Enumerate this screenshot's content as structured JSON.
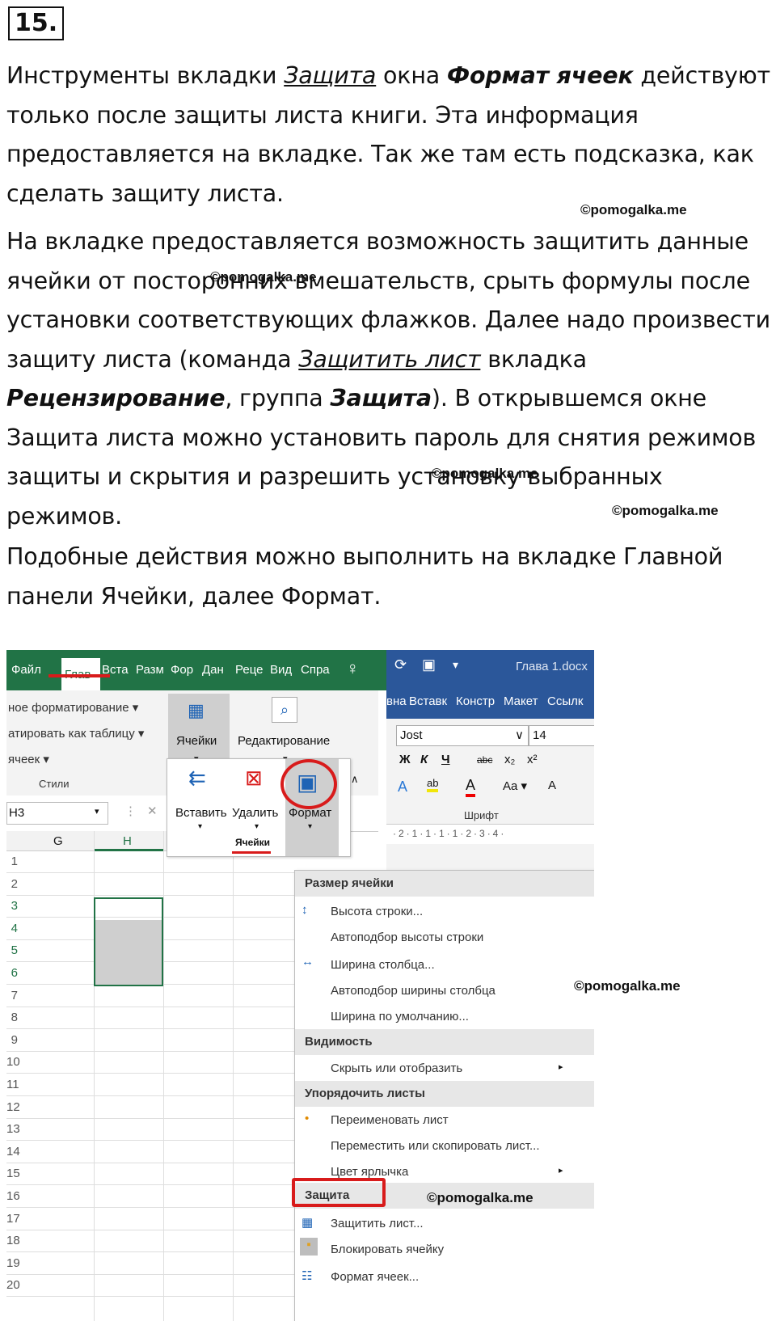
{
  "task_number": "15.",
  "para1": {
    "t1": "Инструменты вкладки ",
    "u1": "Защита",
    "t2": " окна ",
    "b1": "Формат ячеек",
    "t3": " действуют только после защиты листа книги. Эта информация предоставляется на вкладке. Так же там есть подсказка, как сделать защиту листа."
  },
  "para2": {
    "t1": "На вкладке предоставляется возможность защитить данные ячейки от посторонних вмешательств, срыть формулы после установки соответствующих флажков. Далее надо произвести защиту листа (команда ",
    "u1": "Защитить лист",
    "t2": " вкладка ",
    "b1": "Рецензирование",
    "t3": ", группа ",
    "b2": "Защита",
    "t4": "). В открывшемся окне Защита листа можно установить пароль для снятия режимов защиты и скрытия и разрешить установку выбранных режимов."
  },
  "para3": "Подобные действия можно выполнить на вкладке Главной панели Ячейки, далее Формат.",
  "watermark": "©pomogalka.me",
  "excel": {
    "tabs": [
      "Файл",
      "Глав",
      "Вста",
      "Разм",
      "Фор",
      "Дан",
      "Реце",
      "Вид",
      "Спра"
    ],
    "styles_items": [
      "ное форматирование ▾",
      "атировать как таблицу ▾",
      "ячеек ▾"
    ],
    "styles_group": "Стили",
    "cells_label": "Ячейки",
    "edit_label": "Редактирование",
    "name_box": "H3",
    "col_g": "G",
    "col_h": "H",
    "insert_label": "Вставить",
    "delete_label": "Удалить",
    "format_label": "Формат",
    "cells_group": "Ячейки",
    "rows": [
      "1",
      "2",
      "3",
      "4",
      "5",
      "6",
      "7",
      "8",
      "9",
      "10",
      "11",
      "12",
      "13",
      "14",
      "15",
      "16",
      "17",
      "18",
      "19",
      "20"
    ]
  },
  "word": {
    "title": "Глава 1.docx",
    "tabs": [
      "вна",
      "Вставк",
      "Констр",
      "Макет",
      "Ссылк"
    ],
    "font": "Jost",
    "size": "14",
    "font_group": "Шрифт",
    "ruler": "·2·1·1·1·1·2·3·4·"
  },
  "menu": {
    "h1": "Размер ячейки",
    "i1": "Высота строки...",
    "i2": "Автоподбор высоты строки",
    "i3": "Ширина столбца...",
    "i4": "Автоподбор ширины столбца",
    "i5": "Ширина по умолчанию...",
    "h2": "Видимость",
    "i6": "Скрыть или отобразить",
    "h3": "Упорядочить листы",
    "i7": "Переименовать лист",
    "i8": "Переместить или скопировать лист...",
    "i9": "Цвет ярлычка",
    "h4": "Защита",
    "i10": "Защитить лист...",
    "i11": "Блокировать ячейку",
    "i12": "Формат ячеек..."
  },
  "colors": {
    "excel_green": "#217346",
    "word_blue": "#2b579a",
    "highlight_red": "#d81b1b"
  }
}
